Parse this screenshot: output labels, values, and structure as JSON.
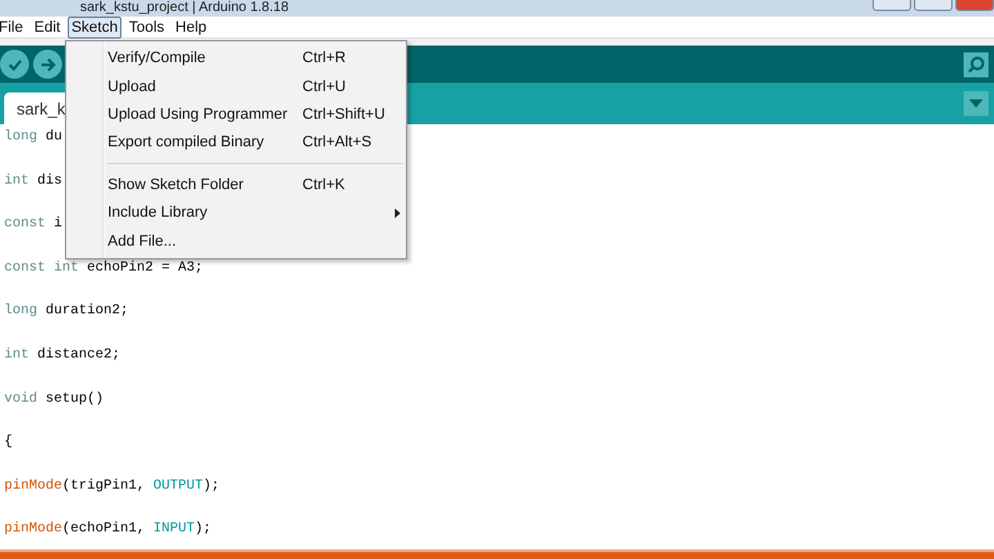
{
  "window": {
    "title": "sark_kstu_project | Arduino 1.8.18"
  },
  "menu_bar": [
    {
      "label": "File",
      "selected": false
    },
    {
      "label": "Edit",
      "selected": false
    },
    {
      "label": "Sketch",
      "selected": true
    },
    {
      "label": "Tools",
      "selected": false
    },
    {
      "label": "Help",
      "selected": false
    }
  ],
  "tabs": [
    {
      "label": "sark_k",
      "selected": true
    }
  ],
  "code_lines": [
    [
      {
        "text": "long",
        "kind": "type"
      },
      {
        "text": " du",
        "kind": "plain"
      }
    ],
    [
      {
        "text": "int",
        "kind": "type"
      },
      {
        "text": " dis",
        "kind": "plain"
      }
    ],
    [
      {
        "text": "const",
        "kind": "type"
      },
      {
        "text": " i",
        "kind": "plain"
      }
    ],
    [
      {
        "text": "const int",
        "kind": "type"
      },
      {
        "text": " echoPin2 = A3;",
        "kind": "plain"
      }
    ],
    [
      {
        "text": "long",
        "kind": "type"
      },
      {
        "text": " duration2;",
        "kind": "plain"
      }
    ],
    [
      {
        "text": "int",
        "kind": "type"
      },
      {
        "text": " distance2;",
        "kind": "plain"
      }
    ],
    [
      {
        "text": "void",
        "kind": "type"
      },
      {
        "text": " setup()",
        "kind": "plain"
      }
    ],
    [
      {
        "text": "{",
        "kind": "plain"
      }
    ],
    [
      {
        "text": "pinMode",
        "kind": "function"
      },
      {
        "text": "(trigPin1, ",
        "kind": "plain"
      },
      {
        "text": "OUTPUT",
        "kind": "constant"
      },
      {
        "text": ");",
        "kind": "plain"
      }
    ],
    [
      {
        "text": "pinMode",
        "kind": "function"
      },
      {
        "text": "(echoPin1, ",
        "kind": "plain"
      },
      {
        "text": "INPUT",
        "kind": "constant"
      },
      {
        "text": ");",
        "kind": "plain"
      }
    ]
  ],
  "sketch_menu": [
    {
      "kind": "item",
      "label": "Verify/Compile",
      "shortcut": "Ctrl+R"
    },
    {
      "kind": "item",
      "label": "Upload",
      "shortcut": "Ctrl+U"
    },
    {
      "kind": "item",
      "label": "Upload Using Programmer",
      "shortcut": "Ctrl+Shift+U"
    },
    {
      "kind": "item",
      "label": "Export compiled Binary",
      "shortcut": "Ctrl+Alt+S"
    },
    {
      "kind": "separator"
    },
    {
      "kind": "item",
      "label": "Show Sketch Folder",
      "shortcut": "Ctrl+K"
    },
    {
      "kind": "submenu",
      "label": "Include Library"
    },
    {
      "kind": "item",
      "label": "Add File..."
    }
  ]
}
